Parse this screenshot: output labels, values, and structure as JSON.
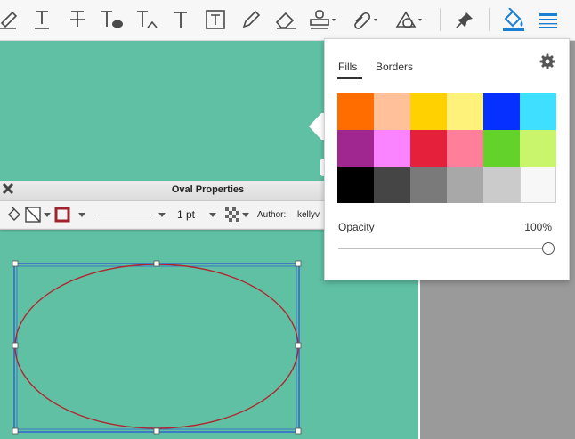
{
  "toolbar": {
    "icons": [
      "highlight-icon",
      "underline-text-icon",
      "strikethrough-text-icon",
      "replace-text-icon",
      "insert-text-icon",
      "add-text-icon",
      "text-box-icon",
      "pencil-icon",
      "eraser-icon",
      "stamp-icon",
      "attach-icon",
      "shapes-icon",
      "pin-icon",
      "fill-color-icon",
      "line-style-icon"
    ]
  },
  "properties": {
    "title": "Oval Properties",
    "line_width": "1 pt",
    "author_label": "Author:",
    "author_value": "kellyv",
    "border_color": "#a0222b"
  },
  "panel": {
    "tabs": [
      "Fills",
      "Borders"
    ],
    "active_tab": "Fills",
    "swatches": [
      "#ff6c00",
      "#ffc09a",
      "#ffd100",
      "#fff27a",
      "#0530ff",
      "#3fe0ff",
      "#a0278f",
      "#fa83ff",
      "#e5203a",
      "#ff7f9a",
      "#63d22b",
      "#c9f56d",
      "#000000",
      "#454545",
      "#7a7a7a",
      "#a8a8a8",
      "#cbcbcb",
      "#f7f7f7"
    ],
    "opacity_label": "Opacity",
    "opacity_value": "100%",
    "opacity_level": 1.0
  },
  "colors": {
    "canvas": "#5fc0a3",
    "accent": "#1a7fd1",
    "oval_stroke": "#b2252f",
    "selection": "#3366cc"
  }
}
